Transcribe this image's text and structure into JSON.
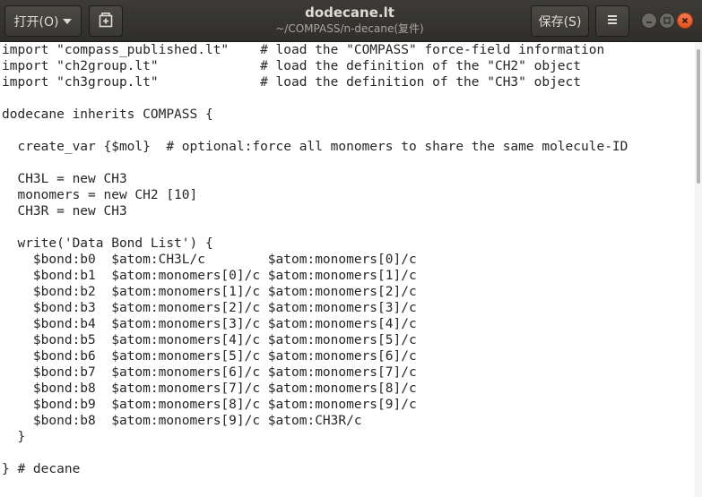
{
  "header": {
    "open_label": "打开(O)",
    "save_label": "保存(S)",
    "title": "dodecane.lt",
    "subtitle": "~/COMPASS/n-decane(复件)"
  },
  "editor": {
    "lines": [
      "import \"compass_published.lt\"    # load the \"COMPASS\" force-field information",
      "import \"ch2group.lt\"             # load the definition of the \"CH2\" object",
      "import \"ch3group.lt\"             # load the definition of the \"CH3\" object",
      "",
      "dodecane inherits COMPASS {",
      "",
      "  create_var {$mol}  # optional:force all monomers to share the same molecule-ID",
      "",
      "  CH3L = new CH3",
      "  monomers = new CH2 [10]",
      "  CH3R = new CH3",
      "",
      "  write('Data Bond List') {",
      "    $bond:b0  $atom:CH3L/c        $atom:monomers[0]/c",
      "    $bond:b1  $atom:monomers[0]/c $atom:monomers[1]/c",
      "    $bond:b2  $atom:monomers[1]/c $atom:monomers[2]/c",
      "    $bond:b3  $atom:monomers[2]/c $atom:monomers[3]/c",
      "    $bond:b4  $atom:monomers[3]/c $atom:monomers[4]/c",
      "    $bond:b5  $atom:monomers[4]/c $atom:monomers[5]/c",
      "    $bond:b6  $atom:monomers[5]/c $atom:monomers[6]/c",
      "    $bond:b7  $atom:monomers[6]/c $atom:monomers[7]/c",
      "    $bond:b8  $atom:monomers[7]/c $atom:monomers[8]/c",
      "    $bond:b9  $atom:monomers[8]/c $atom:monomers[9]/c",
      "    $bond:b8  $atom:monomers[9]/c $atom:CH3R/c",
      "  }",
      "",
      "} # decane"
    ]
  },
  "icons": {
    "open_caret": "chevron-down-icon",
    "new_document": "new-document-icon",
    "menu": "hamburger-menu-icon",
    "minimize": "minimize-icon",
    "maximize": "maximize-icon",
    "close": "close-icon"
  },
  "colors": {
    "headerbar": "#3c3b37",
    "close_button": "#e95420",
    "text": "#262626"
  }
}
